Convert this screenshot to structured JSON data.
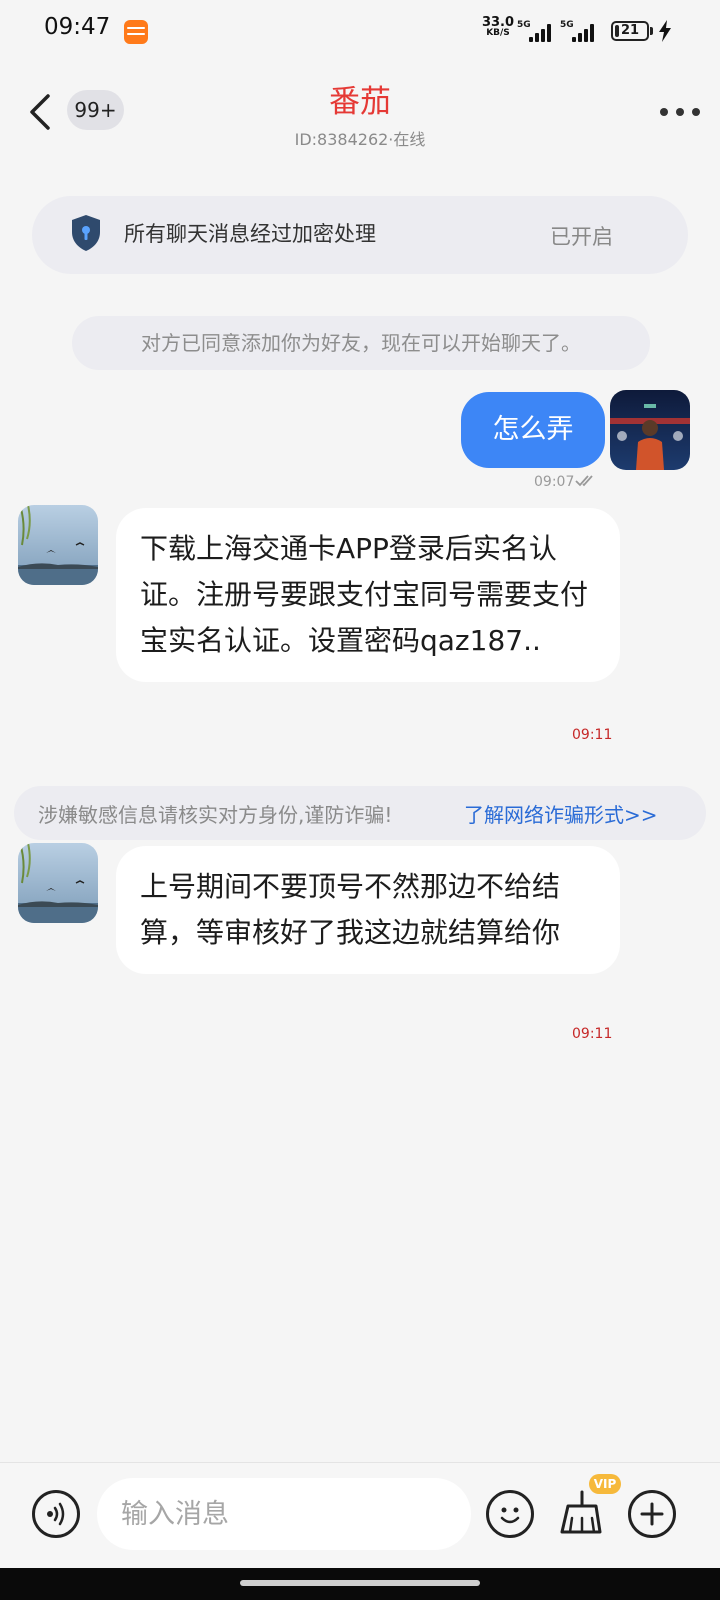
{
  "status_bar": {
    "time": "09:47",
    "net_speed_value": "33.0",
    "net_speed_unit": "KB/S",
    "signal_1": "5G",
    "signal_2": "5G",
    "battery": "21"
  },
  "header": {
    "unread_count": "99+",
    "title": "番茄",
    "subtitle": "ID:8384262·在线"
  },
  "encryption": {
    "text": "所有聊天消息经过加密处理",
    "state": "已开启"
  },
  "system_note": "对方已同意添加你为好友，现在可以开始聊天了。",
  "messages": [
    {
      "direction": "out",
      "text": "怎么弄",
      "time": "09:07"
    },
    {
      "direction": "in",
      "text": " 下载上海交通卡APP登录后实名认证。注册号要跟支付宝同号需要支付宝实名认证。设置密码qaz187..",
      "time": "09:11"
    },
    {
      "direction": "in",
      "text": "上号期间不要顶号不然那边不给结算，等审核好了我这边就结算给你",
      "time": "09:11"
    }
  ],
  "warning": {
    "text": "涉嫌敏感信息请核实对方身份,谨防诈骗!",
    "link": "了解网络诈骗形式>>"
  },
  "composer": {
    "placeholder": "输入消息",
    "vip_badge": "VIP"
  },
  "colors": {
    "title_red": "#e53935",
    "bubble_blue": "#3d86f6",
    "link_blue": "#2a6bd6",
    "time_red": "#c62828"
  },
  "icons": [
    "back-arrow-icon",
    "more-icon",
    "shield-icon",
    "read-check-icon",
    "voice-icon",
    "emoji-icon",
    "broom-icon",
    "plus-icon"
  ]
}
